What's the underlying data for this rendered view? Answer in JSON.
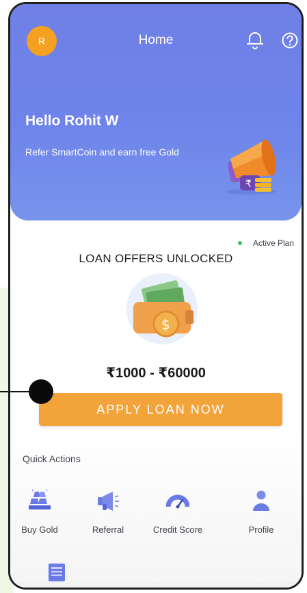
{
  "header": {
    "avatar_initial": "R",
    "title": "Home",
    "icons": [
      "bell-icon",
      "help-circle-icon"
    ]
  },
  "hero": {
    "greeting": "Hello Rohit W",
    "refer_text": "Refer SmartCoin and earn free Gold",
    "illustration": "megaphone-icon"
  },
  "loan": {
    "status": "Active Plan",
    "title": "LOAN OFFERS UNLOCKED",
    "range": "₹1000 - ₹60000",
    "apply_label": "APPLY LOAN NOW"
  },
  "quick_actions": {
    "title": "Quick Actions",
    "items": [
      {
        "label": "Buy Gold",
        "icon": "gold-bars-icon"
      },
      {
        "label": "Referral",
        "icon": "megaphone-icon"
      },
      {
        "label": "Credit Score",
        "icon": "gauge-icon"
      },
      {
        "label": "Profile",
        "icon": "person-icon"
      }
    ]
  },
  "colors": {
    "hero_blue": "#6f7fe6",
    "accent_orange": "#f2a33a",
    "avatar_orange": "#f4a020",
    "status_green": "#3cc45c"
  }
}
